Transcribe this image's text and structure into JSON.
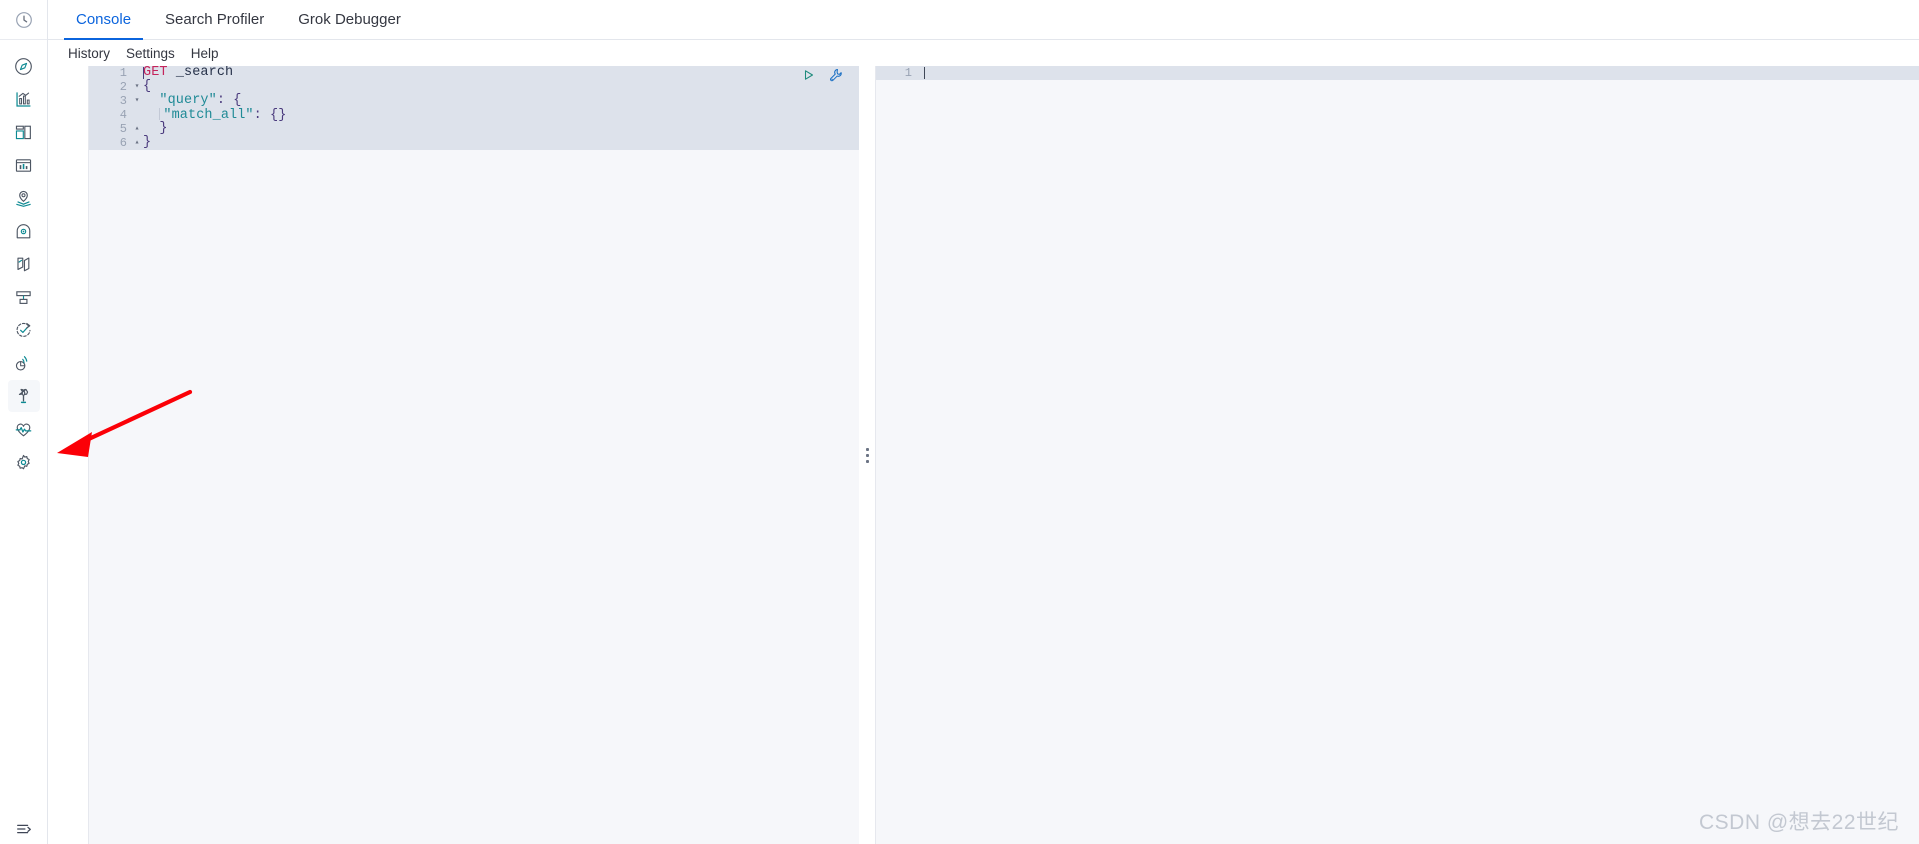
{
  "app": {
    "name": "Kibana Dev Tools Console",
    "accent_color": "#0b64dd",
    "teal_color": "#0d8a93",
    "annotation_arrow_color": "#fb0007"
  },
  "sidebar": {
    "top_icon": {
      "name": "recently-viewed-icon",
      "label": "Recently viewed"
    },
    "items": [
      {
        "icon": "discover-icon",
        "label": "Discover",
        "active": false
      },
      {
        "icon": "dashboard-icon",
        "label": "Dashboard",
        "active": false
      },
      {
        "icon": "canvas-icon",
        "label": "Canvas",
        "active": false
      },
      {
        "icon": "visualize-icon",
        "label": "Visualize",
        "active": false
      },
      {
        "icon": "maps-icon",
        "label": "Maps",
        "active": false
      },
      {
        "icon": "machine-learning-icon",
        "label": "Machine Learning",
        "active": false
      },
      {
        "icon": "graph-icon",
        "label": "Graph",
        "active": false
      },
      {
        "icon": "infrastructure-icon",
        "label": "Infrastructure",
        "active": false
      },
      {
        "icon": "uptime-icon",
        "label": "Uptime",
        "active": false
      },
      {
        "icon": "apm-icon",
        "label": "APM",
        "active": false
      },
      {
        "icon": "dev-tools-wrench-icon",
        "label": "Dev Tools",
        "active": true
      },
      {
        "icon": "stack-monitoring-icon",
        "label": "Stack Monitoring",
        "active": false
      },
      {
        "icon": "management-gear-icon",
        "label": "Management",
        "active": false
      }
    ],
    "bottom_icon": {
      "name": "collapse-navigation-icon",
      "label": "Collapse"
    }
  },
  "tabs": [
    {
      "label": "Console",
      "active": true
    },
    {
      "label": "Search Profiler",
      "active": false
    },
    {
      "label": "Grok Debugger",
      "active": false
    }
  ],
  "submenu": [
    {
      "label": "History"
    },
    {
      "label": "Settings"
    },
    {
      "label": "Help"
    }
  ],
  "editor": {
    "actions": [
      {
        "name": "send-request-play-icon",
        "title": "Click to send request"
      },
      {
        "name": "wrench-context-menu-icon",
        "title": "Open documentation"
      }
    ],
    "lines": [
      {
        "number": "1",
        "fold": "",
        "selected": true,
        "segments": [
          {
            "text": "GET",
            "type": "method"
          },
          {
            "text": " ",
            "type": "plain"
          },
          {
            "text": "_search",
            "type": "url"
          }
        ]
      },
      {
        "number": "2",
        "fold": "▾",
        "selected": true,
        "segments": [
          {
            "text": "{",
            "type": "brace"
          }
        ]
      },
      {
        "number": "3",
        "fold": "▾",
        "selected": true,
        "segments": [
          {
            "text": "  ",
            "type": "plain"
          },
          {
            "text": "\"query\"",
            "type": "key"
          },
          {
            "text": ": ",
            "type": "punct"
          },
          {
            "text": "{",
            "type": "brace"
          }
        ]
      },
      {
        "number": "4",
        "fold": "",
        "selected": true,
        "guide": true,
        "segments": [
          {
            "text": "  ",
            "type": "plain"
          },
          {
            "text": "\"match_all\"",
            "type": "key"
          },
          {
            "text": ": ",
            "type": "punct"
          },
          {
            "text": "{}",
            "type": "brace"
          }
        ]
      },
      {
        "number": "5",
        "fold": "▴",
        "selected": true,
        "segments": [
          {
            "text": "  ",
            "type": "plain"
          },
          {
            "text": "}",
            "type": "brace"
          }
        ]
      },
      {
        "number": "6",
        "fold": "▴",
        "selected": true,
        "segments": [
          {
            "text": "}",
            "type": "brace"
          }
        ]
      }
    ]
  },
  "resizer": {
    "name": "panel-resize-handle"
  },
  "output": {
    "lines": [
      {
        "number": "1",
        "text": ""
      }
    ]
  },
  "watermark": {
    "text": "CSDN @想去22世纪"
  }
}
